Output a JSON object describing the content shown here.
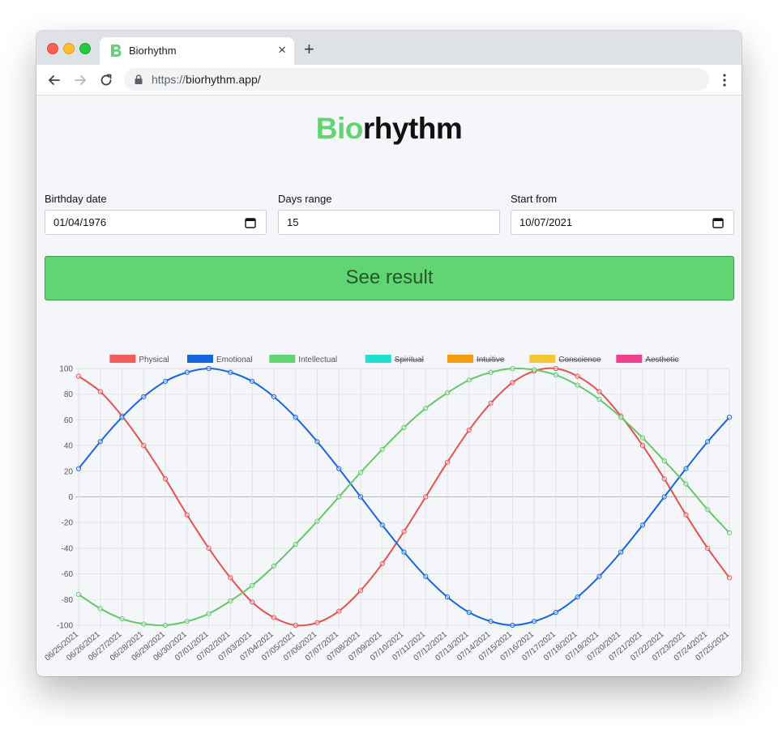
{
  "browser": {
    "tab_title": "Biorhythm",
    "new_tab_icon": "plus-icon",
    "url_protocol": "https://",
    "url_host": "biorhythm.app/"
  },
  "page": {
    "title_accent": "Bio",
    "title_rest": "rhythm",
    "birthday_label": "Birthday date",
    "birthday_value": "01/04/1976",
    "days_label": "Days range",
    "days_value": "15",
    "start_label": "Start from",
    "start_value": "10/07/2021",
    "submit_label": "See result"
  },
  "colors": {
    "accent": "#62d474",
    "physical": "#e5524f",
    "emotional": "#1565e0",
    "intellectual": "#62c96a"
  },
  "chart_data": {
    "type": "line",
    "x": [
      "06/25/2021",
      "06/26/2021",
      "06/27/2021",
      "06/28/2021",
      "06/29/2021",
      "06/30/2021",
      "07/01/2021",
      "07/02/2021",
      "07/03/2021",
      "07/04/2021",
      "07/05/2021",
      "07/06/2021",
      "07/07/2021",
      "07/08/2021",
      "07/09/2021",
      "07/10/2021",
      "07/11/2021",
      "07/12/2021",
      "07/13/2021",
      "07/14/2021",
      "07/15/2021",
      "07/16/2021",
      "07/17/2021",
      "07/18/2021",
      "07/19/2021",
      "07/20/2021",
      "07/21/2021",
      "07/22/2021",
      "07/23/2021",
      "07/24/2021",
      "07/25/2021"
    ],
    "ylim": [
      -100,
      100
    ],
    "yticks": [
      100,
      80,
      60,
      40,
      20,
      0,
      -20,
      -40,
      -60,
      -80,
      -100
    ],
    "grid": true,
    "legend_position": "top",
    "legend": [
      {
        "name": "Physical",
        "color": "#f25c5c",
        "hidden": false
      },
      {
        "name": "Emotional",
        "color": "#1565e0",
        "hidden": false
      },
      {
        "name": "Intellectual",
        "color": "#62d474",
        "hidden": false
      },
      {
        "name": "Spiritual",
        "color": "#1ee0cf",
        "hidden": true
      },
      {
        "name": "Intuitive",
        "color": "#f59a0c",
        "hidden": true
      },
      {
        "name": "Conscience",
        "color": "#f7c634",
        "hidden": true
      },
      {
        "name": "Aesthetic",
        "color": "#f0418f",
        "hidden": true
      }
    ],
    "series": [
      {
        "name": "Physical",
        "color": "#e5524f",
        "values": [
          94,
          82,
          63,
          40,
          14,
          -14,
          -40,
          -63,
          -82,
          -94,
          -100,
          -98,
          -89,
          -73,
          -52,
          -27,
          0,
          27,
          52,
          73,
          89,
          98,
          100,
          94,
          82,
          63,
          40,
          14,
          -14,
          -40,
          -63
        ]
      },
      {
        "name": "Emotional",
        "color": "#1565e0",
        "values": [
          22,
          43,
          62,
          78,
          90,
          97,
          100,
          97,
          90,
          78,
          62,
          43,
          22,
          0,
          -22,
          -43,
          -62,
          -78,
          -90,
          -97,
          -100,
          -97,
          -90,
          -78,
          -62,
          -43,
          -22,
          0,
          22,
          43,
          62
        ]
      },
      {
        "name": "Intellectual",
        "color": "#62c96a",
        "values": [
          -76,
          -87,
          -95,
          -99,
          -100,
          -97,
          -91,
          -81,
          -69,
          -54,
          -37,
          -19,
          0,
          19,
          37,
          54,
          69,
          81,
          91,
          97,
          100,
          99,
          95,
          87,
          76,
          62,
          46,
          28,
          10,
          -10,
          -28
        ]
      }
    ]
  }
}
